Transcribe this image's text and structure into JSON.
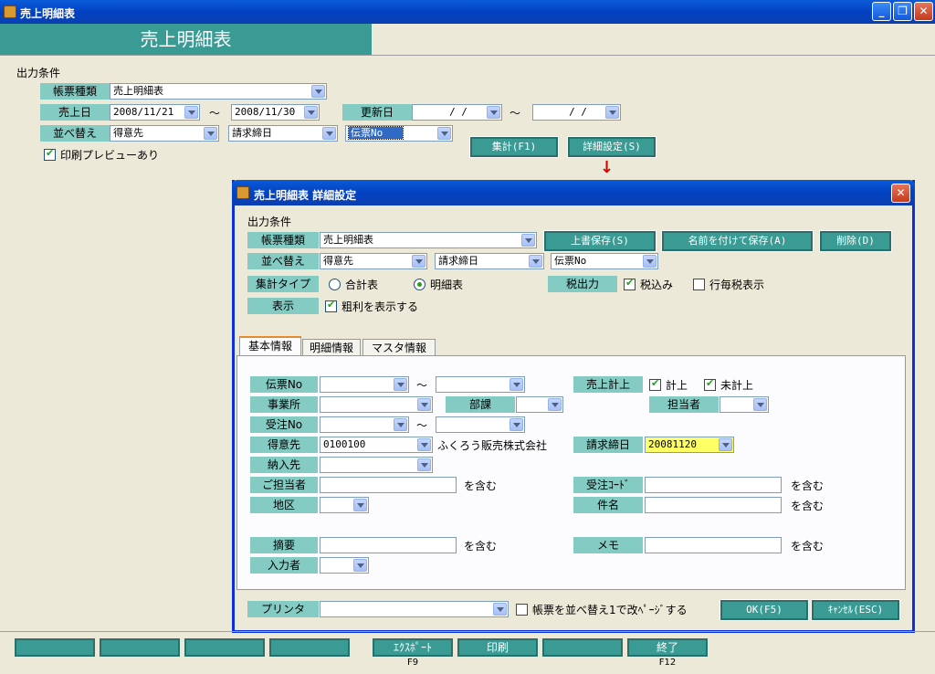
{
  "window": {
    "title": "売上明細表"
  },
  "banner": {
    "title": "売上明細表"
  },
  "main": {
    "section_label": "出力条件",
    "report_type_label": "帳票種類",
    "report_type_value": "売上明細表",
    "sales_date_label": "売上日",
    "sales_date_from": "2008/11/21",
    "sales_date_to": "2008/11/30",
    "range_sep": "～",
    "update_date_label": "更新日",
    "update_date_from": "  /  /",
    "update_date_to": "  /  /",
    "sort_label": "並べ替え",
    "sort1": "得意先",
    "sort2": "請求締日",
    "sort3": "伝票No",
    "preview_label": "印刷プレビューあり",
    "aggregate_button": "集計(F1)",
    "detail_button": "詳細設定(S)"
  },
  "dialog": {
    "title": "売上明細表  詳細設定",
    "section_label": "出力条件",
    "report_type_label": "帳票種類",
    "report_type_value": "売上明細表",
    "overwrite_button": "上書保存(S)",
    "save_as_button": "名前を付けて保存(A)",
    "delete_button": "削除(D)",
    "sort_label": "並べ替え",
    "sort1": "得意先",
    "sort2": "請求締日",
    "sort3": "伝票No",
    "agg_type_label": "集計タイプ",
    "agg_option1": "合計表",
    "agg_option2": "明細表",
    "tax_label": "税出力",
    "tax_included": "税込み",
    "tax_per_line": "行毎税表示",
    "display_label": "表示",
    "show_profit": "粗利を表示する",
    "tabs": [
      "基本情報",
      "明細情報",
      "マスタ情報"
    ],
    "fields": {
      "slip_no": "伝票No",
      "office": "事業所",
      "department": "部課",
      "person": "担当者",
      "order_no": "受注No",
      "customer": "得意先",
      "customer_code": "0100100",
      "customer_name": "ふくろう販売株式会社",
      "billing_close": "請求締日",
      "billing_close_value": "20081120",
      "delivery": "納入先",
      "contact": "ご担当者",
      "order_code": "受注ｺｰﾄﾞ",
      "area": "地区",
      "subject": "件名",
      "summary": "摘要",
      "memo": "メモ",
      "inputter": "入力者",
      "sales_posting": "売上計上",
      "posted": "計上",
      "not_posted": "未計上",
      "contains": "を含む",
      "range_sep": "～"
    },
    "printer_label": "プリンタ",
    "page_break_label": "帳票を並べ替え1で改ﾍﾟｰｼﾞする",
    "ok_button": "OK(F5)",
    "cancel_button": "ｷｬﾝｾﾙ(ESC)"
  },
  "footer": {
    "export_button": "ｴｸｽﾎﾟｰﾄ",
    "export_key": "F9",
    "print_button": "印刷",
    "exit_button": "終了",
    "exit_key": "F12"
  }
}
